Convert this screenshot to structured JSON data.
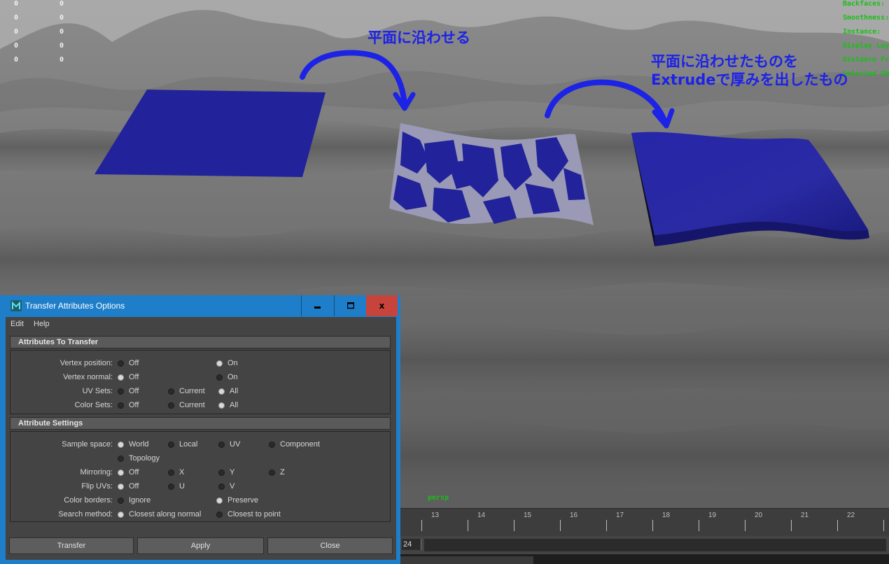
{
  "hud": {
    "left_counters": [
      {
        "a": "0",
        "b": "0"
      },
      {
        "a": "0",
        "b": "0"
      },
      {
        "a": "0",
        "b": "0"
      },
      {
        "a": "0",
        "b": "0"
      },
      {
        "a": "0",
        "b": "0"
      }
    ],
    "right_labels": [
      "Backfaces:",
      "Smoothness:",
      "Instance:",
      "Display Layer",
      "Distance Fr",
      "Selected Ob"
    ]
  },
  "annotations": {
    "label1": "平面に沿わせる",
    "label2_line1": "平面に沿わせたものを",
    "label2_line2": "Extrudeで厚みを出したもの"
  },
  "viewport": {
    "camera_label": "persp"
  },
  "timeline": {
    "ticks": [
      "13",
      "14",
      "15",
      "16",
      "17",
      "18",
      "19",
      "20",
      "21",
      "22"
    ],
    "end_frame": "24"
  },
  "colors": {
    "accent": "#1e7ec9",
    "close": "#c7443c",
    "annotation": "#1c22e6",
    "plane": "#22229a",
    "hud_green": "#16c016"
  },
  "dialog": {
    "title": "Transfer Attributes Options",
    "icon": "maya-app-icon",
    "window_buttons": {
      "minimize": "▁",
      "maximize": "▢",
      "close": "x"
    },
    "menu": [
      "Edit",
      "Help"
    ],
    "section1": {
      "title": "Attributes To Transfer",
      "rows": [
        {
          "label": "Vertex position:",
          "options": [
            {
              "text": "Off",
              "selected": false
            },
            {
              "text": "On",
              "selected": true
            }
          ]
        },
        {
          "label": "Vertex normal:",
          "options": [
            {
              "text": "Off",
              "selected": true
            },
            {
              "text": "On",
              "selected": false
            }
          ]
        },
        {
          "label": "UV Sets:",
          "options": [
            {
              "text": "Off",
              "selected": false
            },
            {
              "text": "Current",
              "selected": false
            },
            {
              "text": "All",
              "selected": true
            }
          ]
        },
        {
          "label": "Color Sets:",
          "options": [
            {
              "text": "Off",
              "selected": false
            },
            {
              "text": "Current",
              "selected": false
            },
            {
              "text": "All",
              "selected": true
            }
          ]
        }
      ]
    },
    "section2": {
      "title": "Attribute Settings",
      "sample_space": {
        "label": "Sample space:",
        "options": [
          "World",
          "Local",
          "UV",
          "Component",
          "Topology"
        ],
        "selected": "World"
      },
      "mirroring": {
        "label": "Mirroring:",
        "options": [
          "Off",
          "X",
          "Y",
          "Z"
        ],
        "selected": "Off"
      },
      "flip_uvs": {
        "label": "Flip UVs:",
        "options": [
          "Off",
          "U",
          "V"
        ],
        "selected": "Off"
      },
      "color_borders": {
        "label": "Color borders:",
        "options": [
          "Ignore",
          "Preserve"
        ],
        "selected": "Preserve"
      },
      "search_method": {
        "label": "Search method:",
        "options": [
          "Closest along normal",
          "Closest to point"
        ],
        "selected": "Closest along normal"
      }
    },
    "buttons": {
      "transfer": "Transfer",
      "apply": "Apply",
      "close": "Close"
    }
  }
}
